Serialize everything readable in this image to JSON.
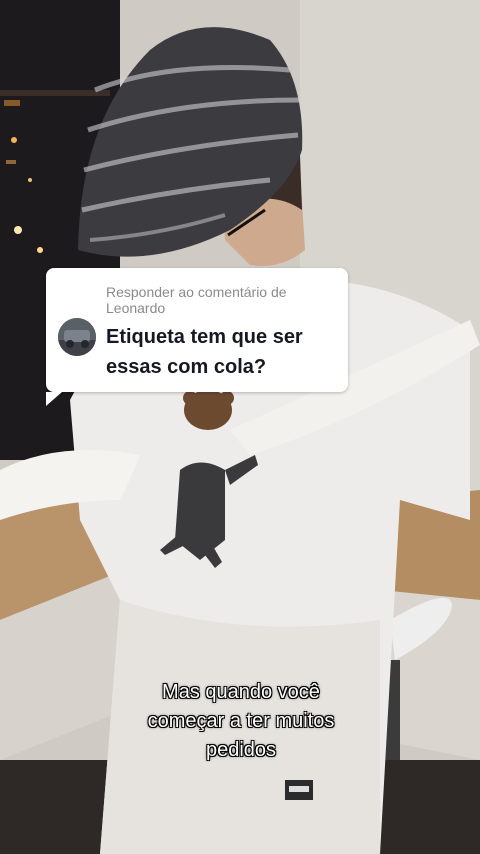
{
  "reply": {
    "header": "Responder ao comentário de",
    "commenter": "Leonardo",
    "comment_lines": [
      "Etiqueta tem que ser",
      "essas com cola?"
    ],
    "avatar_icon": "user-avatar-photo"
  },
  "caption": {
    "lines": [
      "Mas quando você",
      "começar a ter muitos",
      "pedidos"
    ]
  },
  "colors": {
    "card_background": "#ffffff",
    "header_text": "#8a8a8a",
    "comment_text": "#161823",
    "caption_text": "#ffffff"
  }
}
